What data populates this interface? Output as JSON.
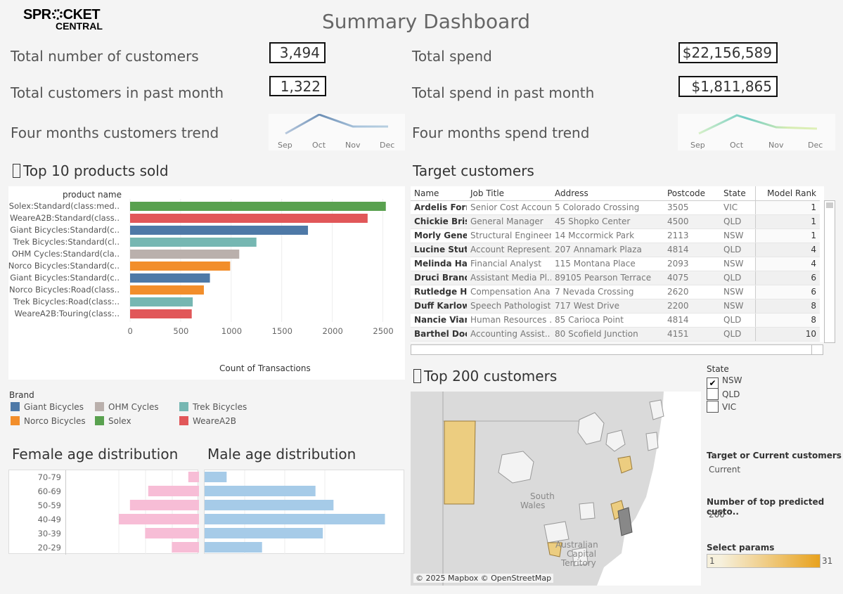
{
  "logo": {
    "line1a": "SPR",
    "line1b": "CKET",
    "line2": "CENTRAL"
  },
  "title": "Summary Dashboard",
  "kpis": {
    "total_customers_label": "Total number of customers",
    "total_customers_value": "3,494",
    "past_month_customers_label": "Total customers in past month",
    "past_month_customers_value": "1,322",
    "customer_trend_label": "Four months customers trend",
    "total_spend_label": "Total spend",
    "total_spend_value": "$22,156,589",
    "past_month_spend_label": "Total spend in past month",
    "past_month_spend_value": "$1,811,865",
    "spend_trend_label": "Four months spend trend"
  },
  "sparklines": {
    "months": [
      "Sep",
      "Oct",
      "Nov",
      "Dec"
    ],
    "customers_line_color": "#7b9bbd",
    "spend_line_color": "#7fd0c0"
  },
  "top_products": {
    "section_title": "Top 10 products sold",
    "header": "product name",
    "axis_title": "Count of Transactions"
  },
  "chart_data": [
    {
      "type": "bar",
      "orientation": "horizontal",
      "categories": [
        "Solex:Standard(class:med..",
        "WeareA2B:Standard(class..",
        "Giant Bicycles:Standard(c..",
        "Trek Bicycles:Standard(cl..",
        "OHM Cycles:Standard(cla..",
        "Norco Bicycles:Standard(c..",
        "Giant Bicycles:Standard(c..",
        "Norco Bicycles:Road(class..",
        "Trek Bicycles:Road(class:..",
        "WeareA2B:Touring(class:.."
      ],
      "values": [
        2530,
        2350,
        1760,
        1250,
        1080,
        990,
        790,
        730,
        620,
        610
      ],
      "bar_colors": [
        "#59a14f",
        "#e15759",
        "#4e79a7",
        "#76b7b2",
        "#bab0ac",
        "#f28e2b",
        "#4e79a7",
        "#f28e2b",
        "#76b7b2",
        "#e15759"
      ],
      "xlabel": "Count of Transactions",
      "ylabel": "product name",
      "xticks": [
        0,
        500,
        1000,
        1500,
        2000,
        2500
      ],
      "xlim": [
        0,
        2650
      ],
      "legend": {
        "title": "Brand",
        "items": [
          {
            "name": "Giant Bicycles",
            "color": "#4e79a7"
          },
          {
            "name": "OHM Cycles",
            "color": "#bab0ac"
          },
          {
            "name": "Trek Bicycles",
            "color": "#76b7b2"
          },
          {
            "name": "Norco Bicycles",
            "color": "#f28e2b"
          },
          {
            "name": "Solex",
            "color": "#59a14f"
          },
          {
            "name": "WeareA2B",
            "color": "#e15759"
          }
        ]
      }
    },
    {
      "type": "bar",
      "orientation": "horizontal",
      "title": "Female age distribution",
      "categories": [
        "70-79",
        "60-69",
        "50-59",
        "40-49",
        "30-39",
        "20-29"
      ],
      "values": [
        24,
        114,
        155,
        180,
        121,
        61
      ],
      "color": "#f7bdd6"
    },
    {
      "type": "bar",
      "orientation": "horizontal",
      "title": "Male age distribution",
      "categories": [
        "70-79",
        "60-69",
        "50-59",
        "40-49",
        "30-39",
        "20-29"
      ],
      "values": [
        33,
        166,
        193,
        270,
        177,
        86
      ],
      "color": "#a6cbe8"
    }
  ],
  "target_customers": {
    "section_title": "Target  customers",
    "columns": [
      "Name",
      "Job Title",
      "Address",
      "Postcode",
      "State",
      "Model Rank"
    ],
    "rows": [
      [
        "Ardelis Forr..",
        "Senior Cost Accoun..",
        "5 Colorado Crossing",
        "3505",
        "VIC",
        "1"
      ],
      [
        "Chickie Bris..",
        "General Manager",
        "45 Shopko Center",
        "4500",
        "QLD",
        "1"
      ],
      [
        "Morly Gene..",
        "Structural Engineer",
        "14 Mccormick Park",
        "2113",
        "NSW",
        "1"
      ],
      [
        "Lucine Stutt",
        "Account Represent..",
        "207 Annamark Plaza",
        "4814",
        "QLD",
        "4"
      ],
      [
        "Melinda Ha..",
        "Financial Analyst",
        "115 Montana Place",
        "2093",
        "NSW",
        "4"
      ],
      [
        "Druci Brandli",
        "Assistant Media Pl..",
        "89105 Pearson Terrace",
        "4075",
        "QLD",
        "6"
      ],
      [
        "Rutledge H..",
        "Compensation Ana..",
        "7 Nevada Crossing",
        "2620",
        "NSW",
        "6"
      ],
      [
        "Duff Karlow..",
        "Speech Pathologist",
        "717 West Drive",
        "2200",
        "NSW",
        "8"
      ],
      [
        "Nancie Vian",
        "Human Resources ..",
        "85 Carioca Point",
        "4814",
        "QLD",
        "8"
      ],
      [
        "Barthel Doc..",
        "Accounting Assist..",
        "80 Scofield Junction",
        "4151",
        "QLD",
        "10"
      ]
    ]
  },
  "top200": {
    "section_title": "Top 200 customers",
    "map_labels": [
      "South",
      "Wales",
      "Australian",
      "Capital",
      "Territory"
    ],
    "attribution": "© 2025 Mapbox © OpenStreetMap"
  },
  "filters": {
    "state_title": "State",
    "states": [
      {
        "label": "NSW",
        "checked": true,
        "mark": "✔"
      },
      {
        "label": "QLD",
        "checked": false,
        "mark": ""
      },
      {
        "label": "VIC",
        "checked": false,
        "mark": ""
      }
    ],
    "target_or_current_title": "Target or Current customers",
    "target_or_current_value": "Current",
    "top_n_title": "Number of top predicted custo..",
    "top_n_value": "200",
    "select_params_title": "Select params",
    "select_params_min": "1",
    "select_params_max": "31",
    "gradient_from": "#f6f0dc",
    "gradient_to": "#e8a21e"
  }
}
